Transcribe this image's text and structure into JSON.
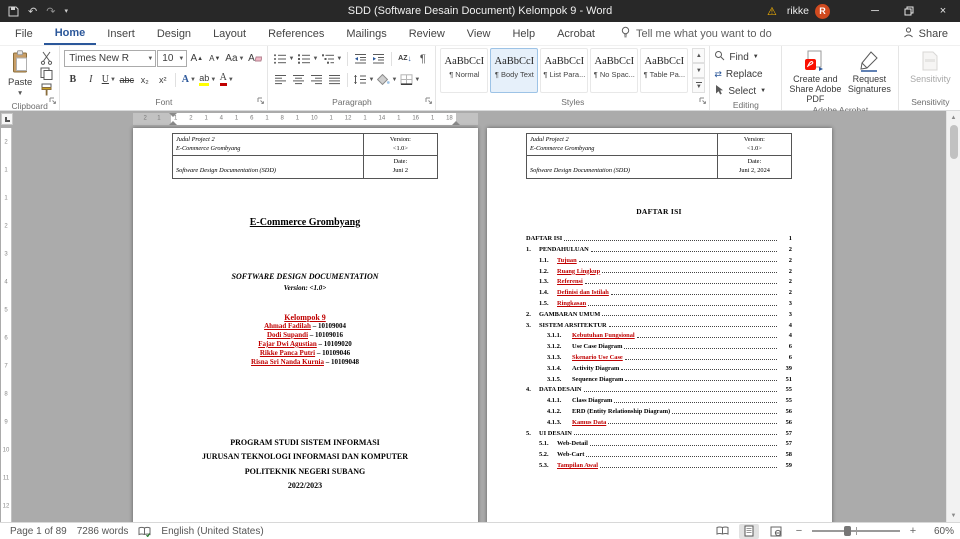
{
  "titlebar": {
    "title": "SDD (Software Desain Document) Kelompok 9 - Word",
    "user": "rikke",
    "avatar_initial": "R"
  },
  "tabs": {
    "items": [
      {
        "label": "File"
      },
      {
        "label": "Home",
        "active": true
      },
      {
        "label": "Insert"
      },
      {
        "label": "Design"
      },
      {
        "label": "Layout"
      },
      {
        "label": "References"
      },
      {
        "label": "Mailings"
      },
      {
        "label": "Review"
      },
      {
        "label": "View"
      },
      {
        "label": "Help"
      },
      {
        "label": "Acrobat"
      }
    ],
    "tellme": "Tell me what you want to do",
    "share": "Share"
  },
  "ribbon": {
    "clipboard": {
      "label": "Clipboard",
      "paste": "Paste"
    },
    "font": {
      "label": "Font",
      "family": "Times New R",
      "size": "10",
      "grow": "A",
      "shrink": "A",
      "case": "Aa",
      "clear": "A",
      "bold": "B",
      "italic": "I",
      "underline": "U",
      "strike": "abc",
      "sub": "x₂",
      "sup": "x²",
      "effects": "A",
      "highlight": "ab",
      "color": "A"
    },
    "paragraph": {
      "label": "Paragraph",
      "sort_letters": "AZ"
    },
    "styles": {
      "label": "Styles",
      "preview": "AaBbCcI",
      "items": [
        {
          "name": "¶ Normal"
        },
        {
          "name": "¶ Body Text",
          "selected": true
        },
        {
          "name": "¶ List Para..."
        },
        {
          "name": "¶ No Spac..."
        },
        {
          "name": "¶ Table Pa..."
        }
      ]
    },
    "editing": {
      "label": "Editing",
      "find": "Find",
      "replace": "Replace",
      "select": "Select"
    },
    "acrobat": {
      "label": "Adobe Acrobat",
      "create": "Create and Share Adobe PDF",
      "request": "Request Signatures"
    },
    "sensitivity": {
      "label": "Sensitivity",
      "button": "Sensitivity"
    }
  },
  "ruler": {
    "h_margin_labels": [
      "2",
      "1"
    ],
    "h_labels": [
      "1",
      "2",
      "1",
      "4",
      "1",
      "6",
      "1",
      "8",
      "1",
      "10",
      "1",
      "12",
      "1",
      "14",
      "1",
      "16",
      "1",
      "18"
    ],
    "v_labels": [
      "2",
      "1",
      "1",
      "2",
      "3",
      "4",
      "5",
      "6",
      "7",
      "8",
      "9",
      "10",
      "11",
      "12"
    ]
  },
  "document": {
    "page1": {
      "header": {
        "title_label": "Judul Project 2",
        "title": "E-Commerce Grombyang",
        "version_label": "Version:",
        "version": "<1.0>",
        "doc_label": "Software Design Documentation (SDD)",
        "date_label": "Date:",
        "date": "Juni 2"
      },
      "cover": {
        "product": "E-Commerce Grombyang",
        "doc_title": "SOFTWARE DESIGN DOCUMENTATION",
        "version_line": "Version: <1.0>",
        "group": "Kelompok 9",
        "separator": "–",
        "members": [
          {
            "name": "Ahmad Fadilah",
            "nim": "10109004"
          },
          {
            "name": "Dodi Supandi",
            "nim": "10109016"
          },
          {
            "name": "Fajar Dwi Agustian",
            "nim": "10109020"
          },
          {
            "name": "Rikke Panca Putri",
            "nim": "10109046"
          },
          {
            "name": "Risna Sri Nanda Kurnia",
            "nim": "10109048"
          }
        ],
        "footer_lines": [
          "PROGRAM STUDI SISTEM INFORMASI",
          "JURUSAN TEKNOLOGI INFORMASI DAN KOMPUTER",
          "POLITEKNIK NEGERI SUBANG",
          "2022/2023"
        ]
      }
    },
    "page2": {
      "header": {
        "title_label": "Judul Project 2",
        "title": "E-Commerce Grombyang",
        "version_label": "Version:",
        "version": "<1.0>",
        "doc_label": "Software Design Documentation (SDD)",
        "date_label": "Date:",
        "date": "Juni 2, 2024"
      },
      "toc": {
        "heading": "DAFTAR ISI",
        "items": [
          {
            "level": 0,
            "num": "",
            "label": "DAFTAR ISI",
            "page": "1"
          },
          {
            "level": 0,
            "num": "1.",
            "label": "PENDAHULUAN",
            "page": "2"
          },
          {
            "level": 1,
            "num": "1.1.",
            "label": "Tujuan",
            "page": "2",
            "red": true
          },
          {
            "level": 1,
            "num": "1.2.",
            "label": "Ruang Lingkup",
            "page": "2",
            "red": true
          },
          {
            "level": 1,
            "num": "1.3.",
            "label": "Referensi",
            "page": "2",
            "red": true
          },
          {
            "level": 1,
            "num": "1.4.",
            "label": "Definisi dan Istilah",
            "page": "2",
            "red": true
          },
          {
            "level": 1,
            "num": "1.5.",
            "label": "Ringkasan",
            "page": "3",
            "red": true
          },
          {
            "level": 0,
            "num": "2.",
            "label": "GAMBARAN UMUM",
            "page": "3"
          },
          {
            "level": 0,
            "num": "3.",
            "label": "SISTEM ARSITEKTUR",
            "page": "4"
          },
          {
            "level": 2,
            "num": "3.1.1.",
            "label": "Kebutuhan Fungsional",
            "page": "4",
            "red": true
          },
          {
            "level": 2,
            "num": "3.1.2.",
            "label": "Use Case Diagram",
            "page": "6"
          },
          {
            "level": 2,
            "num": "3.1.3.",
            "label": "Skenario Use Case",
            "page": "6",
            "red": true
          },
          {
            "level": 2,
            "num": "3.1.4.",
            "label": "Activity Diagram",
            "page": "39"
          },
          {
            "level": 2,
            "num": "3.1.5.",
            "label": "Sequence Diagram",
            "page": "51"
          },
          {
            "level": 0,
            "num": "4.",
            "label": "DATA DESAIN",
            "page": "55"
          },
          {
            "level": 2,
            "num": "4.1.1.",
            "label": "Class Diagram",
            "page": "55"
          },
          {
            "level": 2,
            "num": "4.1.2.",
            "label": "ERD (Entity Relationship Diagram)",
            "page": "56"
          },
          {
            "level": 2,
            "num": "4.1.3.",
            "label": "Kamus Data",
            "page": "56",
            "red": true
          },
          {
            "level": 0,
            "num": "5.",
            "label": "UI DESAIN",
            "page": "57"
          },
          {
            "level": 1,
            "num": "5.1.",
            "label": "Web-Detail",
            "page": "57"
          },
          {
            "level": 1,
            "num": "5.2.",
            "label": "Web-Cart",
            "page": "58"
          },
          {
            "level": 1,
            "num": "5.3.",
            "label": "Tampilan Awal",
            "page": "59",
            "red": true
          }
        ]
      }
    }
  },
  "statusbar": {
    "page": "Page 1 of 89",
    "words": "7286 words",
    "language": "English (United States)",
    "zoom": "60%"
  }
}
